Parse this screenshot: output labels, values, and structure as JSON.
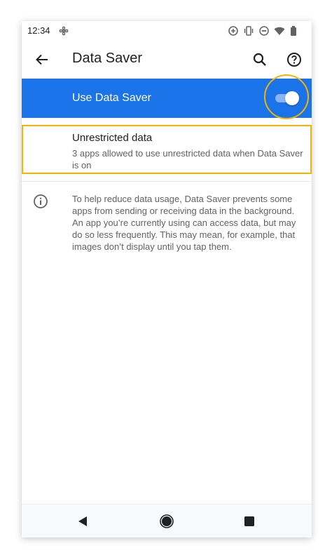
{
  "status_bar": {
    "time": "12:34",
    "left_icons": [
      "fan-icon"
    ],
    "right_icons": [
      "data-saver-status-icon",
      "vibrate-icon",
      "do-not-disturb-icon",
      "wifi-icon",
      "battery-icon"
    ]
  },
  "app_bar": {
    "title": "Data Saver",
    "back_icon": "arrow-left-icon",
    "search_icon": "search-icon",
    "help_icon": "help-circle-icon"
  },
  "master_switch": {
    "label": "Use Data Saver",
    "checked": true,
    "background_color": "#1a73e8",
    "track_color": "#8ab4f8"
  },
  "unrestricted_data": {
    "title": "Unrestricted data",
    "summary": "3 apps allowed to use unrestricted data when Data Saver is on"
  },
  "footer": {
    "icon": "info-icon",
    "text": "To help reduce data usage, Data Saver prevents some apps from sending or receiving data in the background. An app you’re currently using can access data, but may do so less frequently. This may mean, for example, that images don’t display until you tap them."
  },
  "nav_bar": {
    "back_icon": "nav-back-icon",
    "home_icon": "nav-home-icon",
    "recents_icon": "nav-recents-icon"
  },
  "highlight_color": "#f4b400"
}
